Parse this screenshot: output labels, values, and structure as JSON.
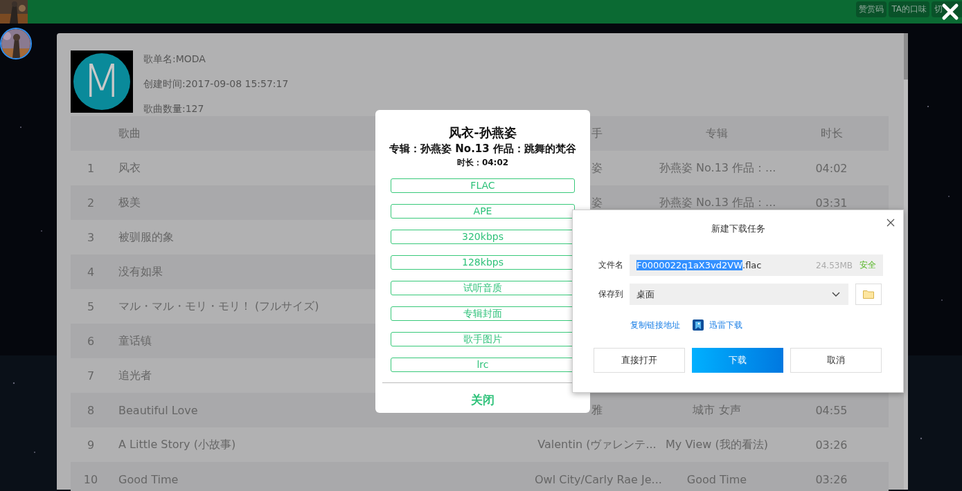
{
  "top_bar": {
    "buttons": [
      {
        "label": "赞赏码"
      },
      {
        "label": "TA的口味"
      },
      {
        "label": "切"
      }
    ]
  },
  "playlist": {
    "cover_letter": "M",
    "name": "歌单名:MODA",
    "created": "创建时间:2017-09-08 15:57:17",
    "count": "歌曲数量:127"
  },
  "table": {
    "columns": [
      "歌曲",
      "手",
      "专辑",
      "时长"
    ],
    "rows": [
      {
        "index": "1",
        "song": "风衣",
        "artist": "姿",
        "album": "孙燕姿 No.13 作品：...",
        "duration": "04:02"
      },
      {
        "index": "2",
        "song": "极美",
        "artist": "姿",
        "album": "孙燕姿 No.13 作品：...",
        "duration": "03:31"
      },
      {
        "index": "3",
        "song": "被驯服的象"
      },
      {
        "index": "4",
        "song": "没有如果"
      },
      {
        "index": "5",
        "song": "マル・マル・モリ・モリ！ (フルサイズ)"
      },
      {
        "index": "6",
        "song": "童话镇"
      },
      {
        "index": "7",
        "song": "追光者"
      },
      {
        "index": "8",
        "song": "Beautiful Love",
        "artist": "雅",
        "album": "城市 女声",
        "duration": "04:55"
      },
      {
        "index": "9",
        "song": "A Little Story (小故事)",
        "artist": "Valentin (ヴァレンテ...",
        "album": "My View (我的看法)",
        "duration": "03:26"
      },
      {
        "index": "10",
        "song": "Good Time",
        "artist": "Owl City/Carly Rae Je...",
        "album": "Good Time",
        "duration": "03:26"
      }
    ]
  },
  "song_modal": {
    "title": "风衣-孙燕姿",
    "album": "专辑：孙燕姿 No.13 作品：跳舞的梵谷",
    "duration": "时长：04:02",
    "options": [
      "FLAC",
      "APE",
      "320kbps",
      "128kbps",
      "试听音质",
      "专辑封面",
      "歌手图片",
      "lrc"
    ],
    "close": "关闭"
  },
  "download_dialog": {
    "title": "新建下载任务",
    "filename_label": "文件名",
    "filename_selected": "F0000022q1aX3vd2VW",
    "filename_rest": ".flac",
    "size": "24.53MB",
    "safety": "安全",
    "save_label": "保存到",
    "save_location": "桌面",
    "links": [
      {
        "label": "复制链接地址",
        "kind": "plain"
      },
      {
        "label": "迅雷下载",
        "kind": "thunder"
      }
    ],
    "buttons": [
      {
        "label": "直接打开",
        "kind": "secondary"
      },
      {
        "label": "下载",
        "kind": "primary"
      },
      {
        "label": "取消",
        "kind": "secondary"
      }
    ]
  }
}
